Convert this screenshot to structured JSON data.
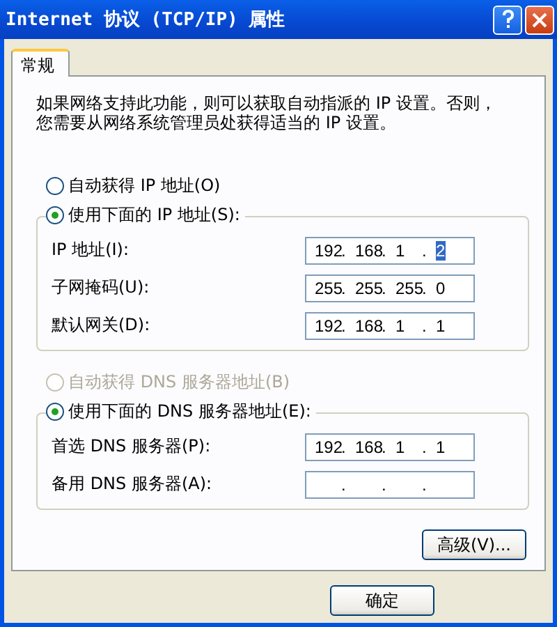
{
  "window": {
    "title": "Internet 协议 (TCP/IP) 属性"
  },
  "tabs": [
    {
      "label": "常规",
      "selected": true
    }
  ],
  "intro_lines": [
    "如果网络支持此功能，则可以获取自动指派的 IP 设置。否则，",
    "您需要从网络系统管理员处获得适当的 IP 设置。"
  ],
  "sections": [
    {
      "radios": [
        {
          "label": "自动获得 IP 地址(O)",
          "selected": false,
          "disabled": false
        },
        {
          "label": "使用下面的 IP 地址(S):",
          "selected": true,
          "disabled": false
        }
      ],
      "fields": [
        {
          "label": "IP 地址(I):",
          "separator": ".",
          "octets": [
            {
              "text": "192",
              "selected": false
            },
            {
              "text": "168",
              "selected": false
            },
            {
              "text": "1",
              "selected": false
            },
            {
              "text": "2",
              "selected": true
            }
          ]
        },
        {
          "label": "子网掩码(U):",
          "separator": ".",
          "octets": [
            {
              "text": "255",
              "selected": false
            },
            {
              "text": "255",
              "selected": false
            },
            {
              "text": "255",
              "selected": false
            },
            {
              "text": "0",
              "selected": false
            }
          ]
        },
        {
          "label": "默认网关(D):",
          "separator": ".",
          "octets": [
            {
              "text": "192",
              "selected": false
            },
            {
              "text": "168",
              "selected": false
            },
            {
              "text": "1",
              "selected": false
            },
            {
              "text": "1",
              "selected": false
            }
          ]
        }
      ]
    },
    {
      "radios": [
        {
          "label": "自动获得 DNS 服务器地址(B)",
          "selected": false,
          "disabled": true
        },
        {
          "label": "使用下面的 DNS 服务器地址(E):",
          "selected": true,
          "disabled": false
        }
      ],
      "fields": [
        {
          "label": "首选 DNS 服务器(P):",
          "separator": ".",
          "octets": [
            {
              "text": "192",
              "selected": false
            },
            {
              "text": "168",
              "selected": false
            },
            {
              "text": "1",
              "selected": false
            },
            {
              "text": "1",
              "selected": false
            }
          ]
        },
        {
          "label": "备用 DNS 服务器(A):",
          "separator": "."
        }
      ]
    }
  ],
  "advanced_button": "高级(V)...",
  "buttons": [
    "确定"
  ]
}
